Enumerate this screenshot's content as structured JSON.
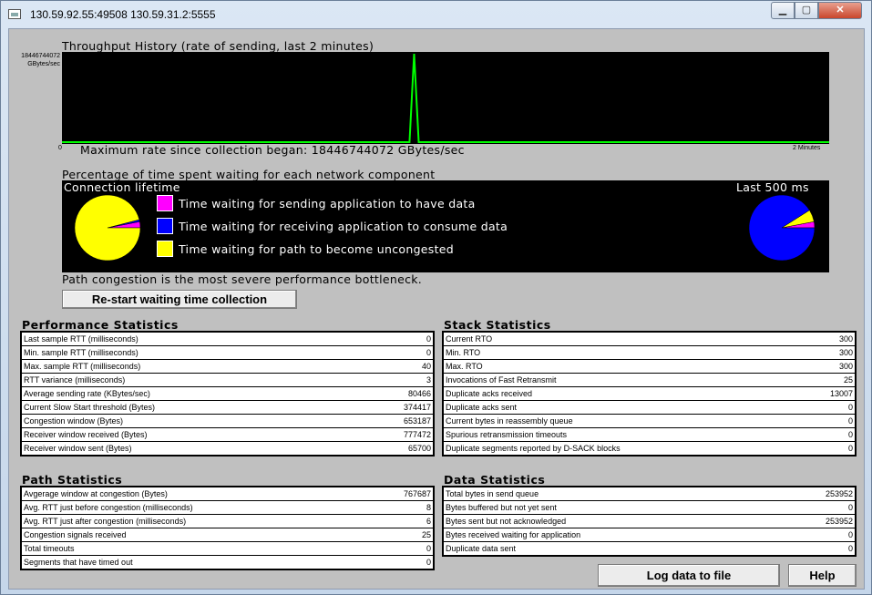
{
  "window": {
    "title": "130.59.92.55:49508 130.59.31.2:5555"
  },
  "throughput": {
    "title": "Throughput History (rate of sending, last 2 minutes)",
    "y_max_label": "18446744072",
    "y_unit_label": "GBytes/sec",
    "x_min_label": "0",
    "x_max_label": "2 Minutes",
    "max_rate_text": "Maximum rate since collection began: 18446744072 GBytes/sec"
  },
  "chart_data": {
    "type": "line",
    "title": "Throughput History (rate of sending, last 2 minutes)",
    "ylabel": "GBytes/sec",
    "xlabel": "",
    "x_range_labels": [
      "0",
      "2 Minutes"
    ],
    "ylim": [
      0,
      18446744072
    ],
    "series": [
      {
        "color": "#00ff00",
        "points": [
          [
            0,
            0
          ],
          [
            0.453,
            0
          ],
          [
            0.459,
            18446744072
          ],
          [
            0.465,
            0
          ],
          [
            1,
            0
          ]
        ]
      }
    ]
  },
  "waiting": {
    "title": "Percentage of time spent waiting for each network component",
    "lifetime_label": "Connection lifetime",
    "last_label": "Last 500 ms",
    "legend": [
      {
        "label": "Time waiting for sending application to have data",
        "color": "#ff00ff"
      },
      {
        "label": "Time waiting for receiving application to consume data",
        "color": "#0000ff"
      },
      {
        "label": "Time waiting for path to become uncongested",
        "color": "#ffff00"
      }
    ],
    "pie_lifetime": [
      {
        "color": "#ff00ff",
        "pct": 3
      },
      {
        "color": "#0000ff",
        "pct": 1
      },
      {
        "color": "#ffff00",
        "pct": 96
      }
    ],
    "pie_last": [
      {
        "color": "#ff00ff",
        "pct": 3
      },
      {
        "color": "#ffff00",
        "pct": 6
      },
      {
        "color": "#0000ff",
        "pct": 91
      }
    ],
    "bottleneck_text": "Path congestion is the most severe performance bottleneck."
  },
  "restart_button": "Re-start waiting time collection",
  "performance": {
    "title": "Performance Statistics",
    "rows": [
      {
        "k": "Last sample RTT (milliseconds)",
        "v": "0"
      },
      {
        "k": "Min. sample RTT (milliseconds)",
        "v": "0"
      },
      {
        "k": "Max. sample RTT (milliseconds)",
        "v": "40"
      },
      {
        "k": "RTT variance (milliseconds)",
        "v": "3"
      },
      {
        "k": "Average sending rate (KBytes/sec)",
        "v": "80466"
      },
      {
        "k": "Current Slow Start threshold (Bytes)",
        "v": "374417"
      },
      {
        "k": "Congestion window (Bytes)",
        "v": "653187"
      },
      {
        "k": "Receiver window received (Bytes)",
        "v": "777472"
      },
      {
        "k": "Receiver window sent (Bytes)",
        "v": "65700"
      }
    ]
  },
  "stack": {
    "title": "Stack Statistics",
    "rows": [
      {
        "k": "Current RTO",
        "v": "300"
      },
      {
        "k": "Min. RTO",
        "v": "300"
      },
      {
        "k": "Max. RTO",
        "v": "300"
      },
      {
        "k": "Invocations of Fast Retransmit",
        "v": "25"
      },
      {
        "k": "Duplicate acks received",
        "v": "13007"
      },
      {
        "k": "Duplicate acks sent",
        "v": "0"
      },
      {
        "k": "Current bytes in reassembly queue",
        "v": "0"
      },
      {
        "k": "Spurious retransmission timeouts",
        "v": "0"
      },
      {
        "k": "Duplicate segments reported by D-SACK blocks",
        "v": "0"
      }
    ]
  },
  "path": {
    "title": "Path Statistics",
    "rows": [
      {
        "k": "Avgerage window at congestion (Bytes)",
        "v": "767687"
      },
      {
        "k": "Avg. RTT just before congestion (milliseconds)",
        "v": "8"
      },
      {
        "k": "Avg. RTT just after congestion (milliseconds)",
        "v": "6"
      },
      {
        "k": "Congestion signals received",
        "v": "25"
      },
      {
        "k": "Total timeouts",
        "v": "0"
      },
      {
        "k": "Segments that have timed out",
        "v": "0"
      }
    ]
  },
  "data_stats": {
    "title": "Data Statistics",
    "rows": [
      {
        "k": "Total bytes in send queue",
        "v": "253952"
      },
      {
        "k": "Bytes buffered but not yet sent",
        "v": "0"
      },
      {
        "k": "Bytes sent but not acknowledged",
        "v": "253952"
      },
      {
        "k": "Bytes received waiting for application",
        "v": "0"
      },
      {
        "k": "Duplicate data sent",
        "v": "0"
      }
    ]
  },
  "buttons": {
    "log": "Log data to file",
    "help": "Help"
  }
}
